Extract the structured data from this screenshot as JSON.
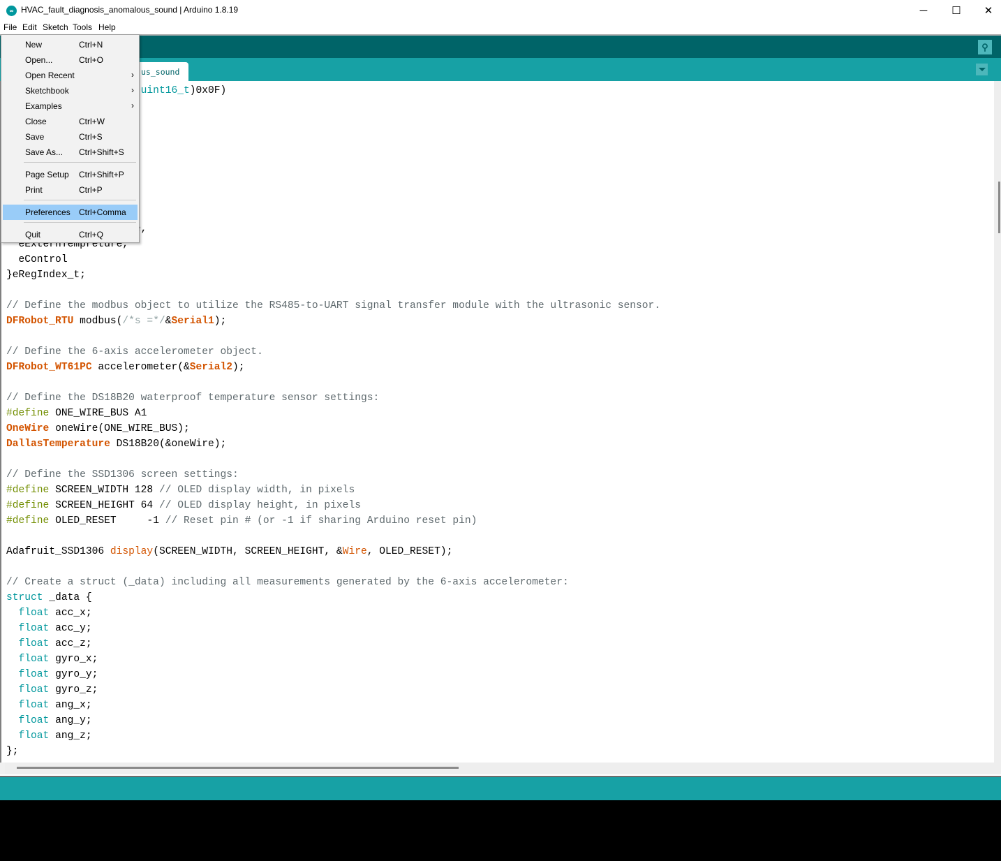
{
  "window": {
    "title": "HVAC_fault_diagnosis_anomalous_sound | Arduino 1.8.19",
    "app_icon": "arduino-logo-icon",
    "controls": {
      "minimize": "─",
      "maximize": "☐",
      "close": "✕"
    }
  },
  "menubar": {
    "items": [
      "File",
      "Edit",
      "Sketch",
      "Tools",
      "Help"
    ]
  },
  "toolbar": {
    "serial_monitor_icon": "⚲"
  },
  "tabs": [
    {
      "label": "us_sound",
      "full_name": "HVAC_fault_diagnosis_anomalous_sound",
      "active": true
    }
  ],
  "file_menu": {
    "items": [
      {
        "label": "New",
        "shortcut": "Ctrl+N"
      },
      {
        "label": "Open...",
        "shortcut": "Ctrl+O"
      },
      {
        "label": "Open Recent",
        "shortcut": "",
        "submenu": "›"
      },
      {
        "label": "Sketchbook",
        "shortcut": "",
        "submenu": "›"
      },
      {
        "label": "Examples",
        "shortcut": "",
        "submenu": "›"
      },
      {
        "label": "Close",
        "shortcut": "Ctrl+W"
      },
      {
        "label": "Save",
        "shortcut": "Ctrl+S"
      },
      {
        "label": "Save As...",
        "shortcut": "Ctrl+Shift+S"
      },
      {
        "label": "Page Setup",
        "shortcut": "Ctrl+Shift+P"
      },
      {
        "label": "Print",
        "shortcut": "Ctrl+P"
      },
      {
        "label": "Preferences",
        "shortcut": "Ctrl+Comma",
        "highlighted": true
      },
      {
        "label": "Quit",
        "shortcut": "Ctrl+Q"
      }
    ]
  },
  "editor": {
    "lines": [
      [
        [
          "",
          "                    "
        ],
        [
          "",
          "((",
          ""
        ],
        [
          "kw",
          "uint16_t"
        ],
        [
          "",
          ")0x0F)"
        ]
      ],
      [],
      [],
      [],
      [],
      [],
      [],
      [],
      [],
      [
        [
          "",
          "                    re,"
        ]
      ],
      [
        [
          "",
          "  eExternTempreture,"
        ]
      ],
      [
        [
          "",
          "  eControl"
        ]
      ],
      [
        [
          "",
          "}eRegIndex_t;"
        ]
      ],
      [],
      [
        [
          "comment",
          "// Define the modbus object to utilize the RS485-to-UART signal transfer module with the ultrasonic sensor."
        ]
      ],
      [
        [
          "type",
          "DFRobot_RTU"
        ],
        [
          "",
          " modbus("
        ],
        [
          "grey",
          "/*s =*/"
        ],
        [
          "",
          "&"
        ],
        [
          "type",
          "Serial1"
        ],
        [
          "",
          ");"
        ]
      ],
      [],
      [
        [
          "comment",
          "// Define the 6-axis accelerometer object."
        ]
      ],
      [
        [
          "type",
          "DFRobot_WT61PC"
        ],
        [
          "",
          " accelerometer(&"
        ],
        [
          "type",
          "Serial2"
        ],
        [
          "",
          ");"
        ]
      ],
      [],
      [
        [
          "comment",
          "// Define the DS18B20 waterproof temperature sensor settings:"
        ]
      ],
      [
        [
          "pre",
          "#define"
        ],
        [
          "",
          " ONE_WIRE_BUS A1"
        ]
      ],
      [
        [
          "type",
          "OneWire"
        ],
        [
          "",
          " oneWire(ONE_WIRE_BUS);"
        ]
      ],
      [
        [
          "type",
          "DallasTemperature"
        ],
        [
          "",
          " DS18B20(&oneWire);"
        ]
      ],
      [],
      [
        [
          "comment",
          "// Define the SSD1306 screen settings:"
        ]
      ],
      [
        [
          "pre",
          "#define"
        ],
        [
          "",
          " SCREEN_WIDTH 128 "
        ],
        [
          "comment",
          "// OLED display width, in pixels"
        ]
      ],
      [
        [
          "pre",
          "#define"
        ],
        [
          "",
          " SCREEN_HEIGHT 64 "
        ],
        [
          "comment",
          "// OLED display height, in pixels"
        ]
      ],
      [
        [
          "pre",
          "#define"
        ],
        [
          "",
          " OLED_RESET     -1 "
        ],
        [
          "comment",
          "// Reset pin # (or -1 if sharing Arduino reset pin)"
        ]
      ],
      [],
      [
        [
          "",
          "Adafruit_SSD1306 "
        ],
        [
          "func",
          "display"
        ],
        [
          "",
          "(SCREEN_WIDTH, SCREEN_HEIGHT, &"
        ],
        [
          "func",
          "Wire"
        ],
        [
          "",
          ", OLED_RESET);"
        ]
      ],
      [],
      [
        [
          "comment",
          "// Create a struct (_data) including all measurements generated by the 6-axis accelerometer:"
        ]
      ],
      [
        [
          "kw",
          "struct"
        ],
        [
          "",
          " _data {"
        ]
      ],
      [
        [
          "",
          "  "
        ],
        [
          "kw",
          "float"
        ],
        [
          "",
          " acc_x;"
        ]
      ],
      [
        [
          "",
          "  "
        ],
        [
          "kw",
          "float"
        ],
        [
          "",
          " acc_y;"
        ]
      ],
      [
        [
          "",
          "  "
        ],
        [
          "kw",
          "float"
        ],
        [
          "",
          " acc_z;"
        ]
      ],
      [
        [
          "",
          "  "
        ],
        [
          "kw",
          "float"
        ],
        [
          "",
          " gyro_x;"
        ]
      ],
      [
        [
          "",
          "  "
        ],
        [
          "kw",
          "float"
        ],
        [
          "",
          " gyro_y;"
        ]
      ],
      [
        [
          "",
          "  "
        ],
        [
          "kw",
          "float"
        ],
        [
          "",
          " gyro_z;"
        ]
      ],
      [
        [
          "",
          "  "
        ],
        [
          "kw",
          "float"
        ],
        [
          "",
          " ang_x;"
        ]
      ],
      [
        [
          "",
          "  "
        ],
        [
          "kw",
          "float"
        ],
        [
          "",
          " ang_y;"
        ]
      ],
      [
        [
          "",
          "  "
        ],
        [
          "kw",
          "float"
        ],
        [
          "",
          " ang_z;"
        ]
      ],
      [
        [
          "",
          "};"
        ]
      ]
    ]
  },
  "colors": {
    "toolbar": "#006468",
    "tabbar": "#17a1a5",
    "statusbar": "#17a1a5",
    "console": "#000000",
    "menu_highlight": "#99ccf8",
    "keyword": "#00979c",
    "type": "#d35400",
    "preprocessor": "#728e00",
    "comment": "#434f54"
  }
}
